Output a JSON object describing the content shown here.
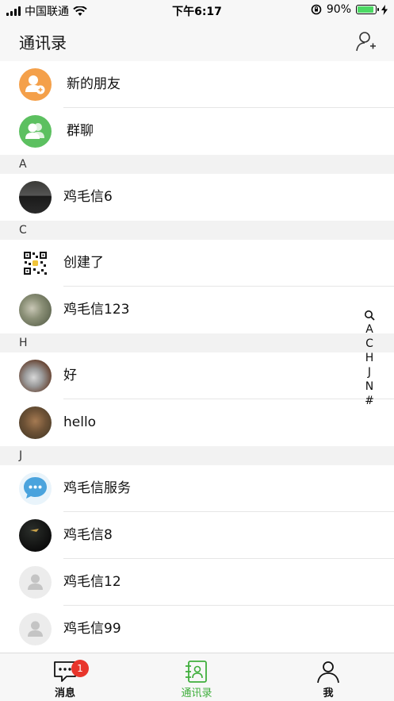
{
  "status_bar": {
    "carrier": "中国联通",
    "time": "下午6:17",
    "battery": "90%",
    "battery_level": 0.9
  },
  "header": {
    "title": "通讯录"
  },
  "fixed_items": [
    {
      "label": "新的朋友",
      "icon": "new-friend-icon",
      "color": "#f4a04a"
    },
    {
      "label": "群聊",
      "icon": "group-chat-icon",
      "color": "#5cc060"
    }
  ],
  "sections": [
    {
      "letter": "A",
      "contacts": [
        {
          "name": "鸡毛信6"
        }
      ]
    },
    {
      "letter": "C",
      "contacts": [
        {
          "name": "创建了"
        },
        {
          "name": "鸡毛信123"
        }
      ]
    },
    {
      "letter": "H",
      "contacts": [
        {
          "name": "好"
        },
        {
          "name": "hello"
        }
      ]
    },
    {
      "letter": "J",
      "contacts": [
        {
          "name": "鸡毛信服务"
        },
        {
          "name": "鸡毛信8"
        },
        {
          "name": "鸡毛信12"
        },
        {
          "name": "鸡毛信99"
        }
      ]
    }
  ],
  "index_bar": [
    "A",
    "C",
    "H",
    "J",
    "N",
    "#"
  ],
  "tabs": [
    {
      "label": "消息",
      "badge": "1",
      "icon": "message-icon"
    },
    {
      "label": "通讯录",
      "icon": "contacts-icon",
      "active": true
    },
    {
      "label": "我",
      "icon": "profile-icon"
    }
  ],
  "colors": {
    "accent": "#3fae3c",
    "badge": "#e8352b",
    "section_bg": "#f2f2f2"
  }
}
